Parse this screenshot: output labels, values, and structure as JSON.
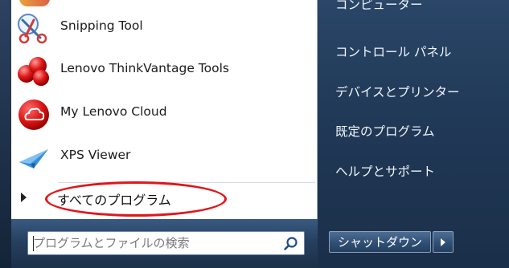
{
  "left_panel": {
    "partial_top_label": "",
    "programs": [
      {
        "label": "Snipping Tool",
        "icon": "scissors-icon"
      },
      {
        "label": "Lenovo ThinkVantage Tools",
        "icon": "thinkvantage-icon"
      },
      {
        "label": "My Lenovo Cloud",
        "icon": "cloud-icon"
      },
      {
        "label": "XPS Viewer",
        "icon": "paper-plane-icon"
      }
    ],
    "all_programs_label": "すべてのプログラム"
  },
  "search": {
    "placeholder": "プログラムとファイルの検索",
    "value": ""
  },
  "right_panel": {
    "items": [
      {
        "label": "コンピューター"
      },
      {
        "label": "コントロール パネル"
      },
      {
        "label": "デバイスとプリンター"
      },
      {
        "label": "既定のプログラム"
      },
      {
        "label": "ヘルプとサポート"
      }
    ],
    "shutdown_label": "シャットダウン"
  },
  "colors": {
    "highlight_oval": "#e0161b",
    "right_panel_bg": "#213a58"
  }
}
